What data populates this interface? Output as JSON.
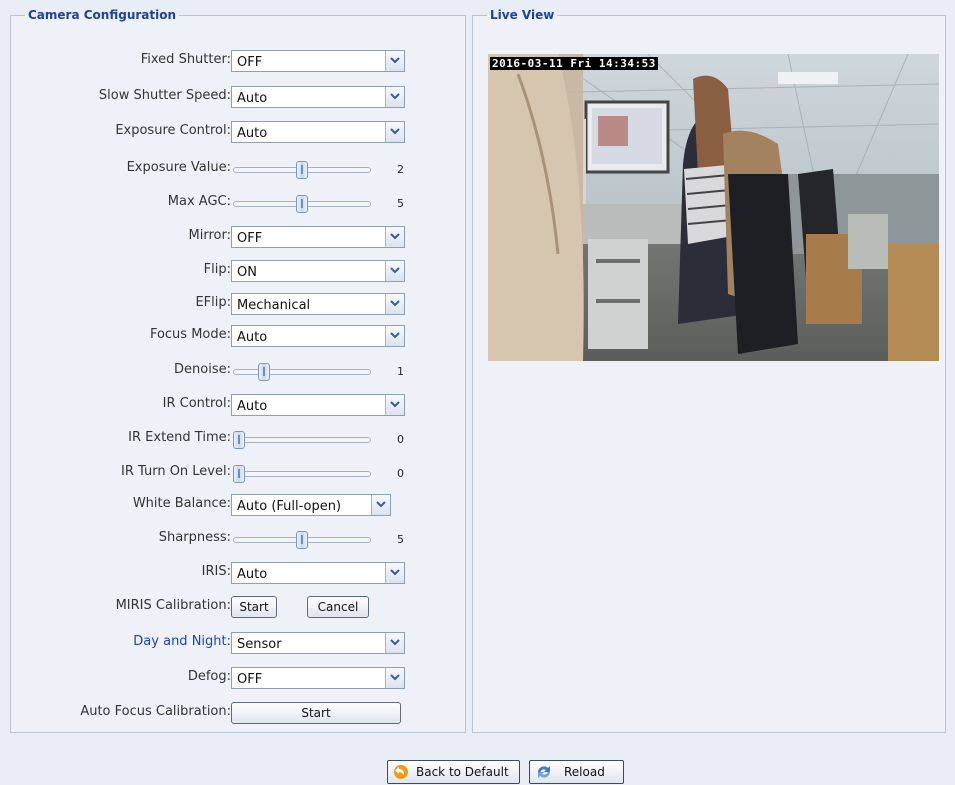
{
  "camera_config": {
    "title": "Camera Configuration",
    "fields": {
      "fixed_shutter": {
        "label": "Fixed Shutter:",
        "value": "OFF"
      },
      "slow_shutter_speed": {
        "label": "Slow Shutter Speed:",
        "value": "Auto"
      },
      "exposure_control": {
        "label": "Exposure Control:",
        "value": "Auto"
      },
      "exposure_value": {
        "label": "Exposure Value:",
        "value": "2",
        "level": 0.5
      },
      "max_agc": {
        "label": "Max AGC:",
        "value": "5",
        "level": 0.5
      },
      "mirror": {
        "label": "Mirror:",
        "value": "OFF"
      },
      "flip": {
        "label": "Flip:",
        "value": "ON"
      },
      "eflip": {
        "label": "EFlip:",
        "value": "Mechanical"
      },
      "focus_mode": {
        "label": "Focus Mode:",
        "value": "Auto"
      },
      "denoise": {
        "label": "Denoise:",
        "value": "1",
        "level": 0.2
      },
      "ir_control": {
        "label": "IR Control:",
        "value": "Auto"
      },
      "ir_extend_time": {
        "label": "IR Extend Time:",
        "value": "0",
        "level": 0.0
      },
      "ir_turn_on_level": {
        "label": "IR Turn On Level:",
        "value": "0",
        "level": 0.0
      },
      "white_balance": {
        "label": "White Balance:",
        "value": "Auto (Full-open)"
      },
      "sharpness": {
        "label": "Sharpness:",
        "value": "5",
        "level": 0.5
      },
      "iris": {
        "label": "IRIS:",
        "value": "Auto"
      },
      "miris_calibration": {
        "label": "MIRIS Calibration:",
        "start": "Start",
        "cancel": "Cancel"
      },
      "day_and_night": {
        "label": "Day and Night:",
        "value": "Sensor"
      },
      "defog": {
        "label": "Defog:",
        "value": "OFF"
      },
      "auto_focus_calibration": {
        "label": "Auto Focus Calibration:",
        "start": "Start"
      }
    }
  },
  "live_view": {
    "title": "Live View",
    "timestamp": "2016-03-11 Fri 14:34:53"
  },
  "footer": {
    "back_to_default": "Back to Default",
    "reload": "Reload"
  },
  "colors": {
    "legend": "#1f3fa3",
    "highlight_label": "#1a3fd1",
    "panel_bg": "#eef2f8"
  }
}
